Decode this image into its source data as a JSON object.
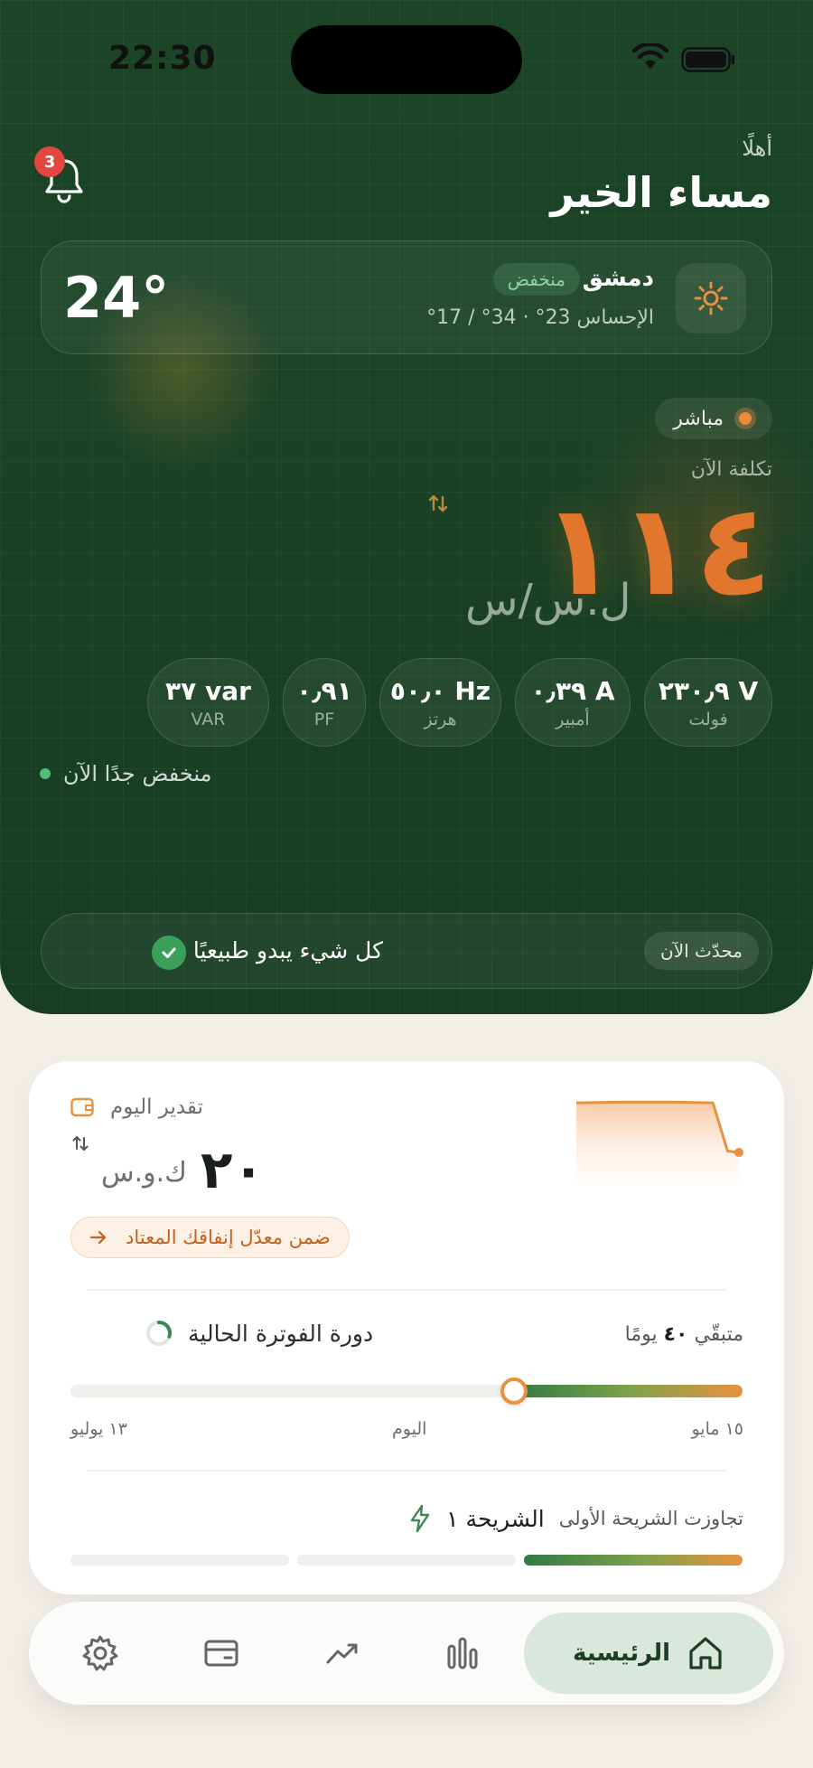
{
  "status_bar": {
    "time": "22:30"
  },
  "header": {
    "greeting_small": "أهلًا",
    "greeting_big": "مساء الخير",
    "notifications_count": "3"
  },
  "weather": {
    "city": "دمشق",
    "status_chip": "منخفض",
    "feels_like": "الإحساس 23° · 34° / 17°",
    "temperature": "24°"
  },
  "live": {
    "label": "مباشر"
  },
  "cost": {
    "label": "تكلفة الآن",
    "value": "١١٤",
    "unit": "ل.س/س"
  },
  "metrics": [
    {
      "value": "٢٣٠٫٩ V",
      "label": "فولت"
    },
    {
      "value": "٠٫٣٩ A",
      "label": "أمبير"
    },
    {
      "value": "٥٠٫٠ Hz",
      "label": "هرتز"
    },
    {
      "value": "٠٫٩١",
      "label": "PF"
    },
    {
      "value": "٣٧ var",
      "label": "VAR"
    }
  ],
  "low_note": "منخفض جدًا الآن",
  "system_status": {
    "message": "كل شيء يبدو طبيعيًا",
    "updated_chip": "محدّث الآن"
  },
  "estimate": {
    "label": "تقدير اليوم",
    "value": "٢٠",
    "unit": "ك.و.س",
    "avg_pill": "ضمن معدّل إنفاقك المعتاد",
    "sparkline": [
      0.95,
      0.96,
      0.96,
      0.95,
      0.3,
      0.28
    ]
  },
  "billing": {
    "title": "دورة الفوترة الحالية",
    "remaining_prefix": "متبقّي",
    "remaining_days": "٤٠",
    "remaining_suffix": "يومًا",
    "progress": 0.34,
    "start_label": "١٥ مايو",
    "today_label": "اليوم",
    "end_label": "١٣ يوليو"
  },
  "tier": {
    "note": "تجاوزت الشريحة الأولى",
    "name": "الشريحة ١",
    "active_segment": 1
  },
  "nav": {
    "home_label": "الرئيسية",
    "items": [
      "home-icon",
      "bar-chart-icon",
      "trend-icon",
      "card-icon",
      "settings-icon"
    ]
  },
  "colors": {
    "hero_green": "#1b4326",
    "accent_orange": "#e2762c",
    "success_green": "#3aa05a",
    "badge_red": "#e2463f"
  }
}
